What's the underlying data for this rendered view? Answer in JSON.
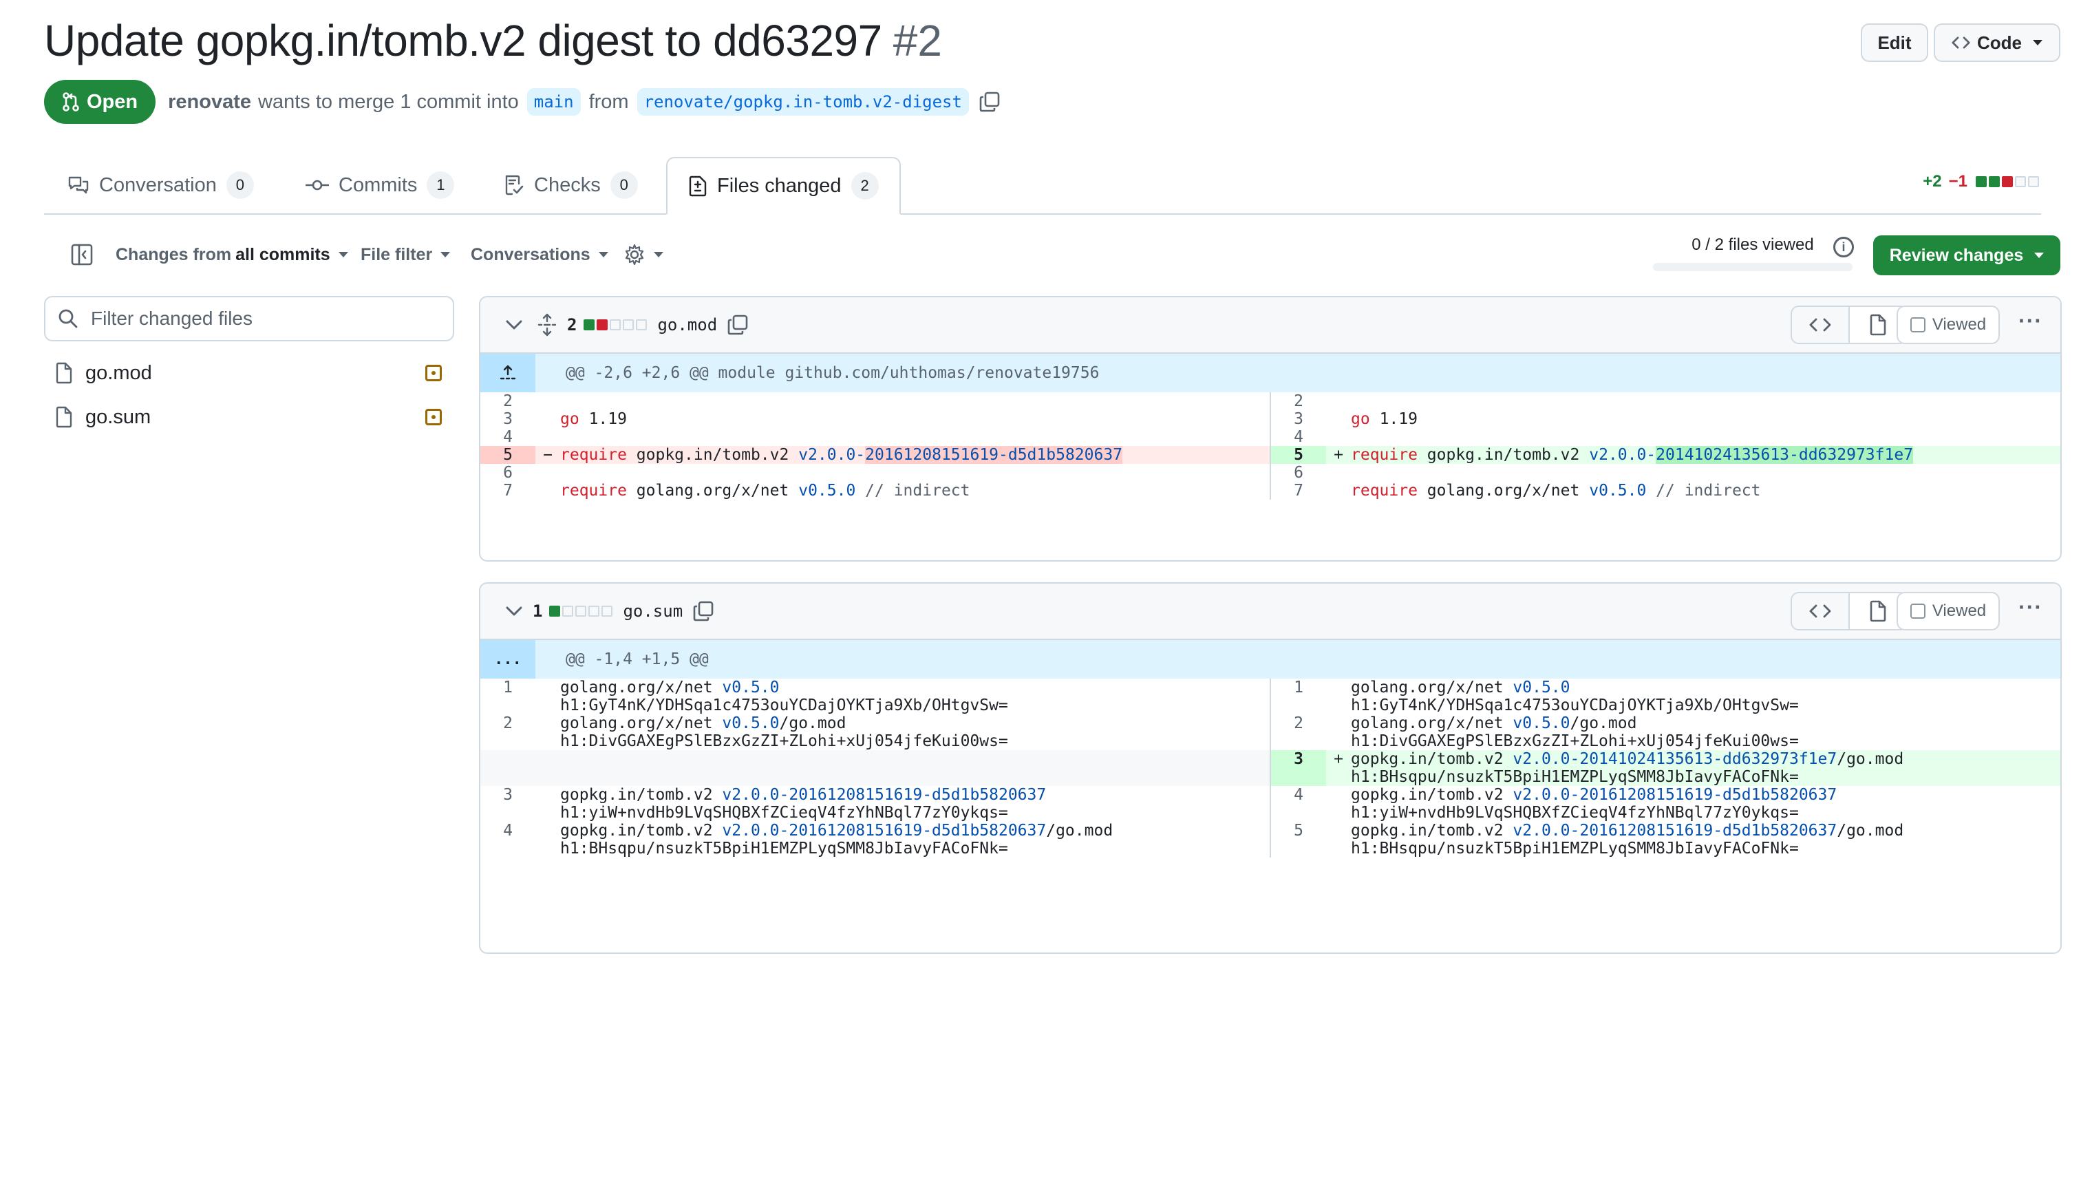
{
  "pr": {
    "title": "Update gopkg.in/tomb.v2 digest to dd63297",
    "number": "#2",
    "state": "Open",
    "author": "renovate",
    "merge_text": "wants to merge 1 commit into",
    "base_branch": "main",
    "from_text": "from",
    "head_branch": "renovate/gopkg.in-tomb.v2-digest"
  },
  "header_buttons": {
    "edit": "Edit",
    "code": "Code"
  },
  "tabs": [
    {
      "label": "Conversation",
      "count": "0"
    },
    {
      "label": "Commits",
      "count": "1"
    },
    {
      "label": "Checks",
      "count": "0"
    },
    {
      "label": "Files changed",
      "count": "2"
    }
  ],
  "diffstat": {
    "additions": "+2",
    "deletions": "−1"
  },
  "toolbar": {
    "changes_prefix": "Changes from",
    "changes_value": "all commits",
    "file_filter": "File filter",
    "conversations": "Conversations",
    "files_viewed": "0 / 2 files viewed",
    "review_changes": "Review changes"
  },
  "sidebar": {
    "filter_placeholder": "Filter changed files",
    "files": [
      "go.mod",
      "go.sum"
    ]
  },
  "files": [
    {
      "changes": "2",
      "name": "go.mod",
      "viewed_label": "Viewed",
      "hunk": "@@ -2,6 +2,6 @@ module github.com/uhthomas/renovate19756",
      "left_lines": [
        "2",
        "3",
        "4",
        "5",
        "6",
        "7"
      ],
      "right_lines": [
        "2",
        "3",
        "4",
        "5",
        "6",
        "7"
      ],
      "code": {
        "go": "go",
        "go_ver": "1.19",
        "require": "require",
        "tomb_pkg": "gopkg.in/tomb.v2",
        "ver_prefix": "v2.0.0-",
        "old_ver": "20161208151619-d5d1b5820637",
        "new_ver": "20141024135613-dd632973f1e7",
        "net_pkg": "golang.org/x/net",
        "net_ver": "v0.5.0",
        "comment": "// indirect"
      }
    },
    {
      "changes": "1",
      "name": "go.sum",
      "viewed_label": "Viewed",
      "hunk": "@@ -1,4 +1,5 @@",
      "expand": "...",
      "rows": [
        {
          "l": "1",
          "r": "1",
          "pkg": "golang.org/x/net",
          "ver": "v0.5.0",
          "suffix": "",
          "hash": "h1:GyT4nK/YDHSqa1c4753ouYCDajOYKTja9Xb/OHtgvSw="
        },
        {
          "l": "2",
          "r": "2",
          "pkg": "golang.org/x/net",
          "ver": "v0.5.0",
          "suffix": "/go.mod",
          "hash": "h1:DivGGAXEgPSlEBzxGzZI+ZLohi+xUj054jfeKui00ws="
        },
        {
          "l": "",
          "r": "3",
          "pkg": "gopkg.in/tomb.v2",
          "ver": "v2.0.0-20141024135613-dd632973f1e7",
          "suffix": "/go.mod",
          "hash": "h1:BHsqpu/nsuzkT5BpiH1EMZPLyqSMM8JbIavyFACoFNk="
        },
        {
          "l": "3",
          "r": "4",
          "pkg": "gopkg.in/tomb.v2",
          "ver": "v2.0.0-20161208151619-d5d1b5820637",
          "suffix": "",
          "hash": "h1:yiW+nvdHb9LVqSHQBXfZCieqV4fzYhNBql77zY0ykqs="
        },
        {
          "l": "4",
          "r": "5",
          "pkg": "gopkg.in/tomb.v2",
          "ver": "v2.0.0-20161208151619-d5d1b5820637",
          "suffix": "/go.mod",
          "hash": "h1:BHsqpu/nsuzkT5BpiH1EMZPLyqSMM8JbIavyFACoFNk="
        }
      ]
    }
  ],
  "colors": {
    "accent_green": "#1f883d",
    "link_blue": "#0969da",
    "deletion_red": "#cf222e",
    "hunk_bg": "#ddf4ff"
  },
  "icons": [
    "git-pull-request-icon",
    "copy-icon",
    "code-icon",
    "comment-discussion-icon",
    "git-commit-icon",
    "checklist-icon",
    "file-diff-icon",
    "sidebar-collapse-icon",
    "gear-icon",
    "info-icon",
    "search-icon",
    "file-icon",
    "file-modified-icon",
    "chevron-down-icon",
    "unfold-icon",
    "fold-up-icon",
    "kebab-horizontal-icon"
  ]
}
